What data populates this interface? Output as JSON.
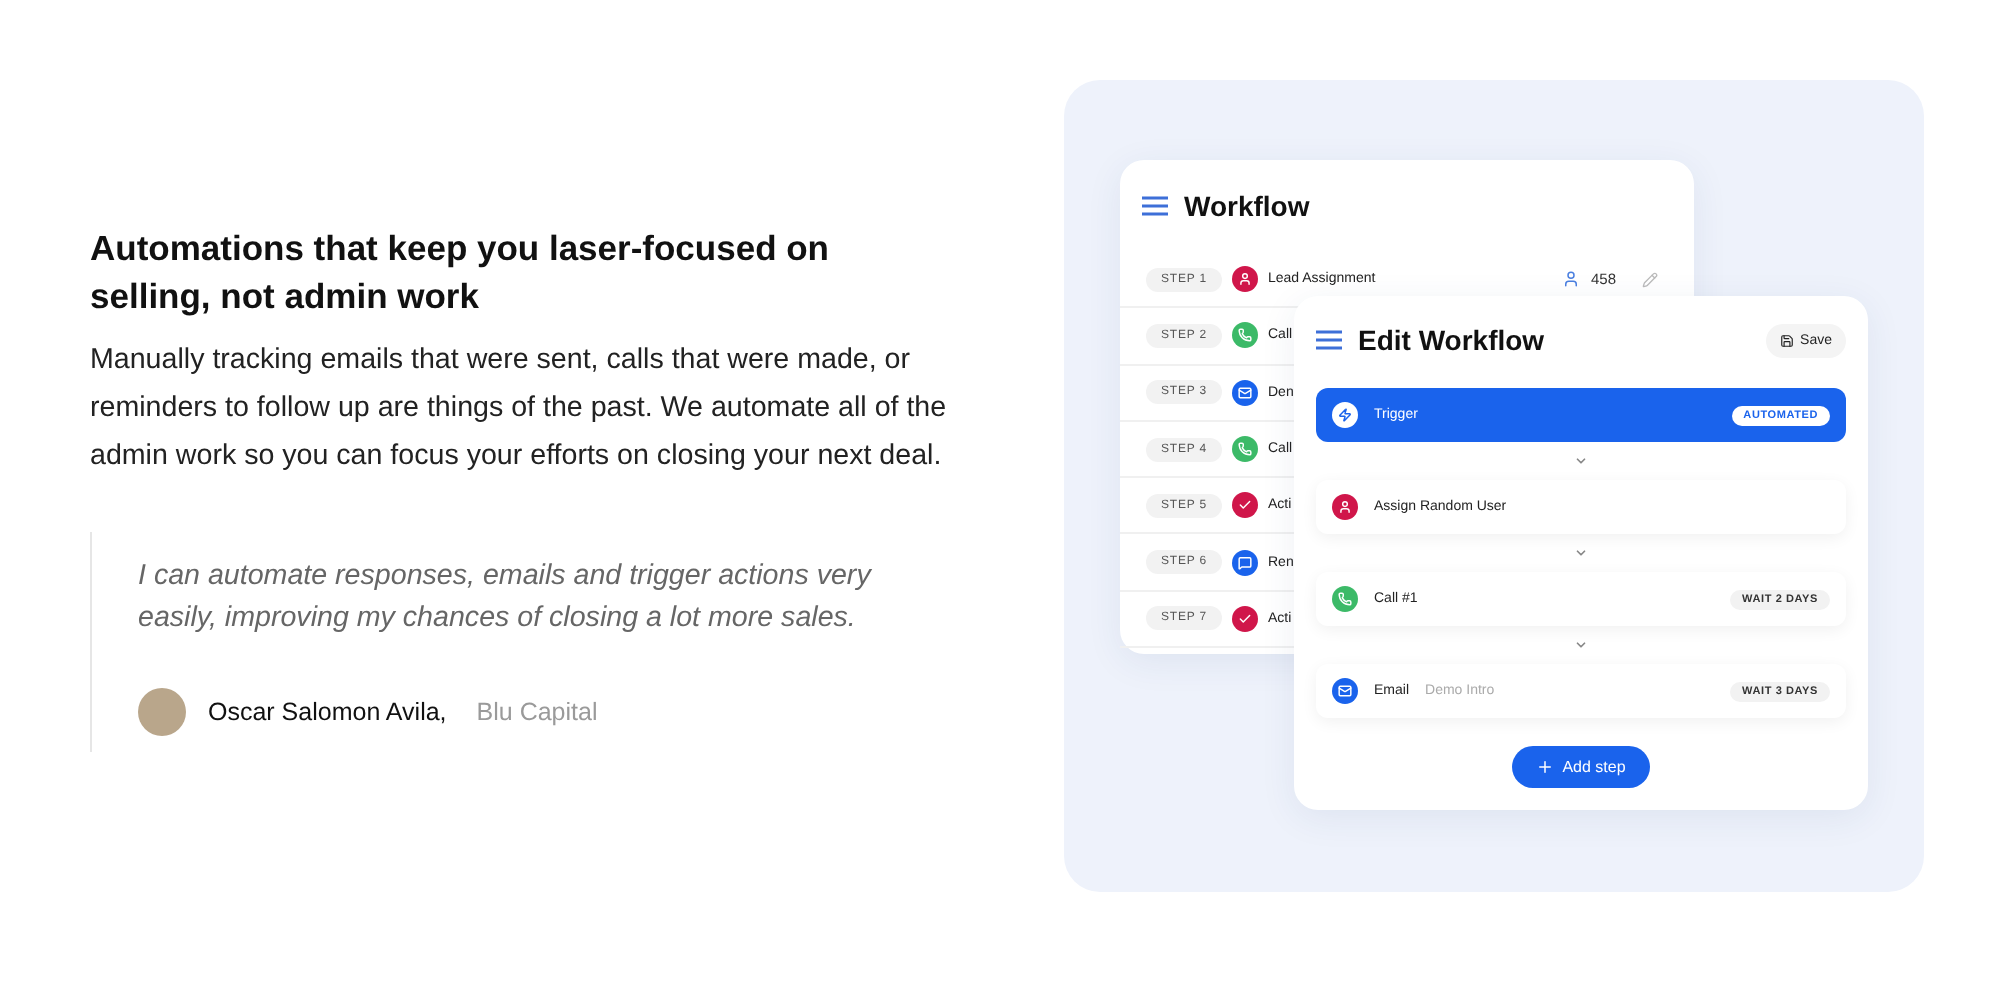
{
  "heading": "Automations that keep you laser-focused on selling, not admin work",
  "paragraph": "Manually tracking emails that were sent, calls that were made, or reminders to follow up are things of the past. We automate all of the admin work so you can focus your efforts on closing your next deal.",
  "quote": {
    "text": "I can automate responses, emails and trigger actions very easily, improving my chances of closing a lot more sales.",
    "author": "Oscar Salomon Avila,",
    "company": "Blu Capital"
  },
  "workflow": {
    "title": "Workflow",
    "steps": [
      {
        "step": "STEP 1",
        "kind": "user",
        "label": "Lead Assignment",
        "count": "458"
      },
      {
        "step": "STEP 2",
        "kind": "call",
        "label": "Call"
      },
      {
        "step": "STEP 3",
        "kind": "email",
        "label": "Den"
      },
      {
        "step": "STEP 4",
        "kind": "call",
        "label": "Call"
      },
      {
        "step": "STEP 5",
        "kind": "check",
        "label": "Acti"
      },
      {
        "step": "STEP 6",
        "kind": "chat",
        "label": "Ren"
      },
      {
        "step": "STEP 7",
        "kind": "check",
        "label": "Acti"
      }
    ]
  },
  "edit_workflow": {
    "title": "Edit Workflow",
    "save": "Save",
    "add_step": "Add step",
    "items": [
      {
        "kind": "trigger",
        "label": "Trigger",
        "badge": "AUTOMATED",
        "selected": true
      },
      {
        "kind": "user",
        "label": "Assign Random User",
        "selected": false
      },
      {
        "kind": "call",
        "label": "Call #1",
        "badge": "WAIT 2 DAYS",
        "selected": false
      },
      {
        "kind": "email",
        "label": "Email",
        "note": "Demo Intro",
        "badge": "WAIT 3 DAYS",
        "selected": false
      }
    ]
  }
}
